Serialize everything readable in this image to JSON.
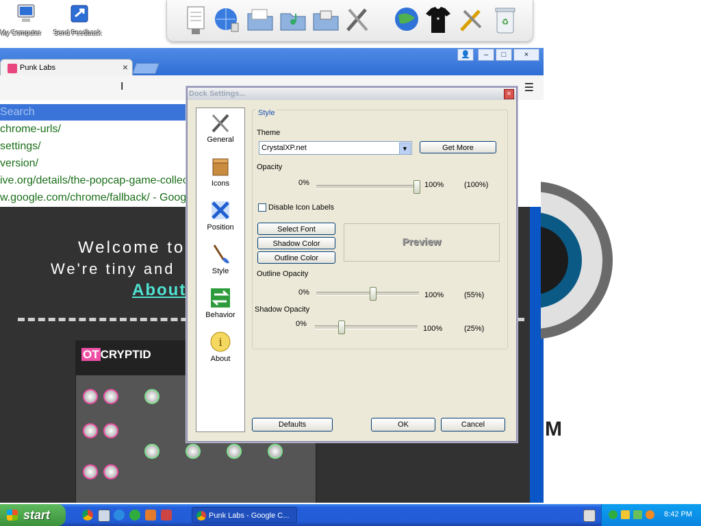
{
  "desktop": {
    "icons": [
      {
        "label": "My Computer",
        "icon": "my-computer-icon"
      },
      {
        "label": "Send Feedback",
        "icon": "send-feedback-icon"
      }
    ]
  },
  "dock": {
    "items": [
      "documents-icon",
      "globe-search-icon",
      "folder-icon",
      "music-folder-icon",
      "pictures-folder-icon",
      "tools-icon",
      "internet-icon",
      "tshirt-icon",
      "settings-tools-icon",
      "recycle-bin-icon"
    ]
  },
  "browser": {
    "tab_title": "Punk Labs",
    "tab_close": "×",
    "window_buttons": {
      "user": "👤",
      "minimize": "–",
      "maximize": "□",
      "close": "×"
    },
    "menu_icon": "☰",
    "suggestions": [
      "Search",
      "chrome-urls/",
      "settings/",
      "version/",
      "ive.org/details/the-popcap-game-collec",
      "w.google.com/chrome/fallback/ - Goog"
    ],
    "page": {
      "welcome": "Welcome to",
      "tiny": "We're tiny and",
      "about": "About",
      "synth_logo_prefix": "OT",
      "synth_logo": "CRYPTID"
    },
    "bg_letter": "M"
  },
  "dialog": {
    "title": "Dock Settings...",
    "close": "×",
    "nav": [
      "General",
      "Icons",
      "Position",
      "Style",
      "Behavior",
      "About"
    ],
    "group_legend": "Style",
    "theme_label": "Theme",
    "theme_value": "CrystalXP.net",
    "get_more": "Get More",
    "opacity_label": "Opacity",
    "opacity": {
      "min": "0%",
      "max": "100%",
      "value_text": "(100%)",
      "value": 100
    },
    "disable_labels": "Disable Icon Labels",
    "select_font": "Select Font",
    "shadow_color": "Shadow Color",
    "outline_color": "Outline Color",
    "preview": "Preview",
    "outline_opacity_label": "Outline Opacity",
    "outline_opacity": {
      "min": "0%",
      "max": "100%",
      "value_text": "(55%)",
      "value": 55
    },
    "shadow_opacity_label": "Shadow Opacity",
    "shadow_opacity": {
      "min": "0%",
      "max": "100%",
      "value_text": "(25%)",
      "value": 25
    },
    "defaults": "Defaults",
    "ok": "OK",
    "cancel": "Cancel"
  },
  "taskbar": {
    "start": "start",
    "task_item": "Punk Labs - Google C...",
    "clock": "8:42 PM"
  }
}
